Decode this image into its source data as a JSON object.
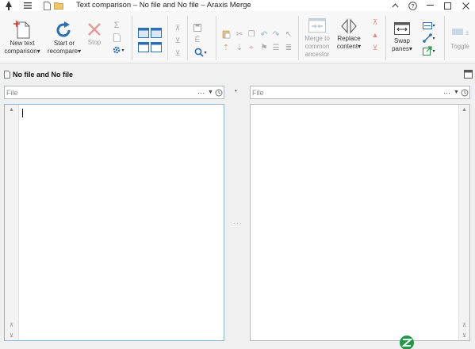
{
  "window": {
    "title": "Text comparison – No file and No file – Araxis Merge",
    "minimize": "–",
    "help": "?",
    "restore": "□",
    "close": "✕"
  },
  "ribbon": {
    "new_text": "New text",
    "new_text_sub": "comparison",
    "start": "Start or",
    "start_sub": "recompare",
    "stop": "Stop",
    "merge": "Merge to",
    "merge_sub1": "common",
    "merge_sub2": "ancestor",
    "replace": "Replace",
    "replace_sub": "content",
    "swap": "Swap",
    "swap_sub": "panes",
    "toggle": "Toggle"
  },
  "document": {
    "title": "No file and No file"
  },
  "left_file": {
    "placeholder": "File",
    "ellipsis": "···"
  },
  "right_file": {
    "placeholder": "File",
    "ellipsis": "···"
  },
  "center_dot": "•",
  "middots": "···",
  "colors": {
    "accent_blue": "#2a6fb5",
    "red_stop": "#d65a5a",
    "pane_border_active": "#8fb3d6"
  }
}
